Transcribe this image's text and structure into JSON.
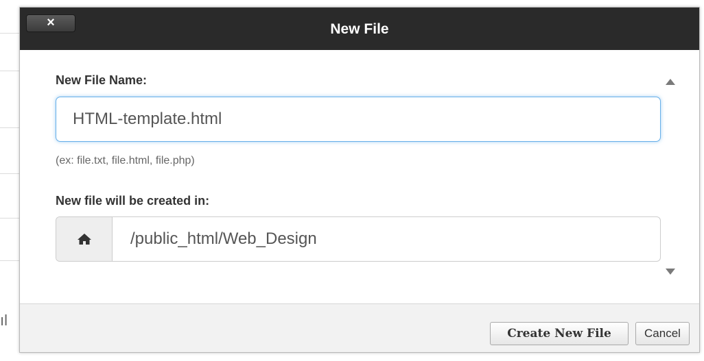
{
  "dialog": {
    "close_label": "×",
    "title": "New File"
  },
  "form": {
    "file_name_label": "New File Name:",
    "file_name_value": "HTML-template.html",
    "file_name_hint": "(ex: file.txt, file.html, file.php)",
    "location_label": "New file will be created in:",
    "location_value": "/public_html/Web_Design",
    "location_icon": "home-icon"
  },
  "footer": {
    "create_label": "Create New File",
    "cancel_label": "Cancel"
  },
  "background": {
    "edge_text": "ıl"
  },
  "colors": {
    "titlebar": "#2a2a2a",
    "focus_border": "#66afe9"
  }
}
